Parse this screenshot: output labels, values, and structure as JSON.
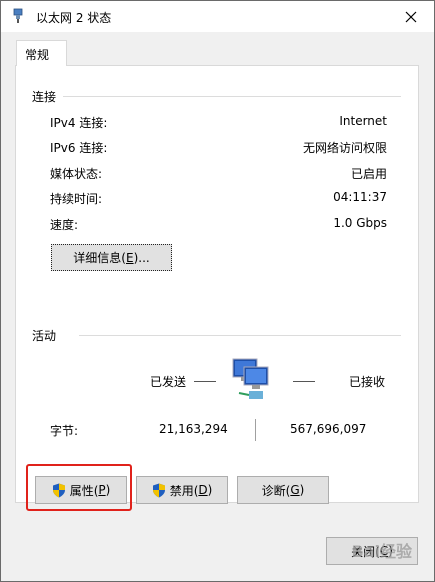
{
  "window": {
    "title": "以太网 2 状态",
    "close_icon": "close-icon",
    "network_icon": "ethernet-icon"
  },
  "tab": {
    "label": "常规"
  },
  "connection": {
    "group_label": "连接",
    "rows": [
      {
        "label": "IPv4 连接:",
        "value": "Internet"
      },
      {
        "label": "IPv6 连接:",
        "value": "无网络访问权限"
      },
      {
        "label": "媒体状态:",
        "value": "已启用"
      },
      {
        "label": "持续时间:",
        "value": "04:11:37"
      },
      {
        "label": "速度:",
        "value": "1.0 Gbps"
      }
    ],
    "details_button": {
      "prefix": "详细信息(",
      "accel": "E",
      "suffix": ")..."
    }
  },
  "activity": {
    "group_label": "活动",
    "sent_label": "已发送",
    "received_label": "已接收",
    "bytes_label": "字节:",
    "bytes_sent": "21,163,294",
    "bytes_received": "567,696,097",
    "icon": "network-computers-icon"
  },
  "buttons": {
    "properties": {
      "prefix": "属性(",
      "accel": "P",
      "suffix": ")"
    },
    "disable": {
      "prefix": "禁用(",
      "accel": "D",
      "suffix": ")"
    },
    "diagnose": {
      "prefix": "诊断(",
      "accel": "G",
      "suffix": ")"
    },
    "close": {
      "prefix": "关闭(",
      "accel": "C",
      "suffix": ")"
    }
  },
  "watermark": "Bai经验",
  "colors": {
    "highlight": "#e0221b",
    "accent": "#0078d7"
  }
}
